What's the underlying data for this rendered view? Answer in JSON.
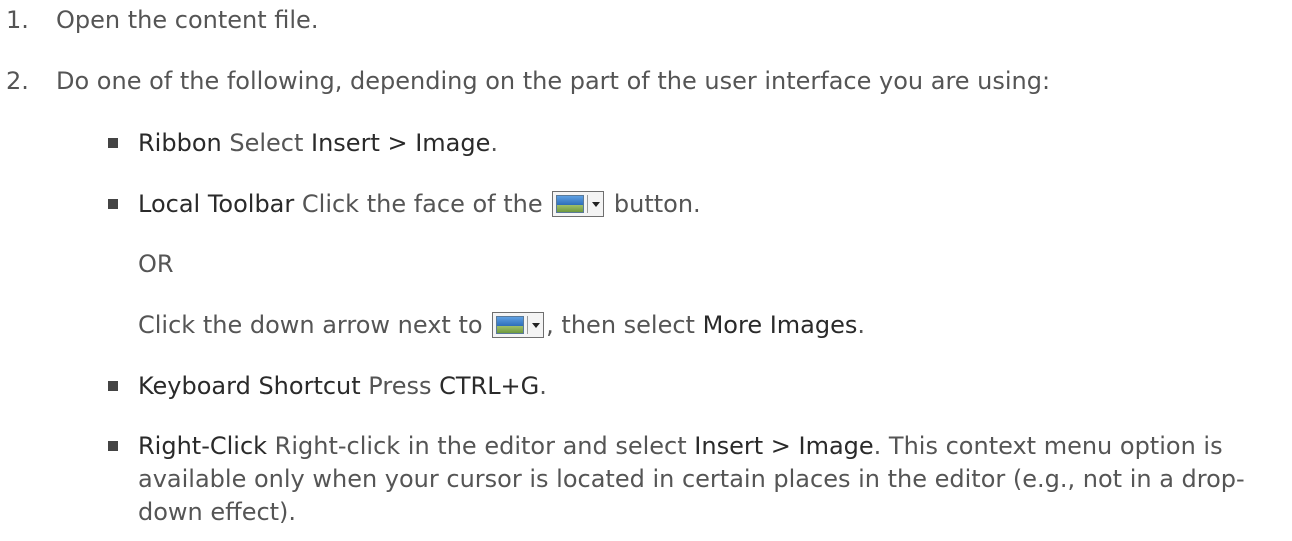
{
  "steps": [
    {
      "number": "1.",
      "text": "Open the content file."
    },
    {
      "number": "2.",
      "text": "Do one of the following, depending on the part of the user interface you are using:"
    }
  ],
  "options": {
    "ribbon": {
      "label": "Ribbon",
      "pre": " Select ",
      "command": "Insert > Image",
      "post": "."
    },
    "local_toolbar": {
      "label": "Local Toolbar",
      "pre": " Click the face of the ",
      "post": " button.",
      "or": "OR",
      "alt_pre": "Click the down arrow next to ",
      "alt_mid": ", then select ",
      "alt_command": "More Images",
      "alt_post": "."
    },
    "keyboard": {
      "label": "Keyboard Shortcut",
      "pre": " Press ",
      "command": "CTRL+G",
      "post": "."
    },
    "right_click": {
      "label": "Right-Click",
      "pre": " Right-click in the editor and select ",
      "command": "Insert > Image",
      "post": ". This context menu option is available only when your cursor is located in certain places in the editor (e.g., not in a drop-down effect)."
    }
  },
  "icons": {
    "toolbar_button": "insert-image-dropdown-icon",
    "bullet": "square-bullet-icon"
  }
}
